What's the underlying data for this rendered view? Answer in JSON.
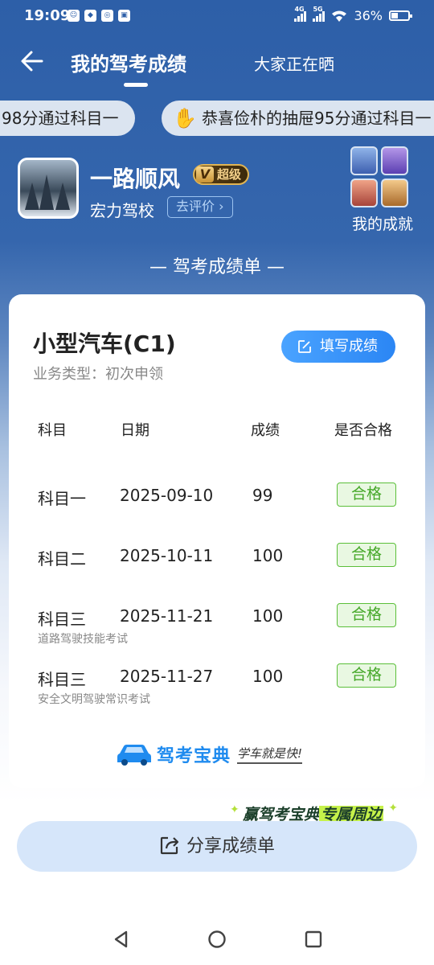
{
  "status": {
    "time": "19:09",
    "net1": "4G",
    "net2": "5G",
    "battery": "36%"
  },
  "header": {
    "tab_active": "我的驾考成绩",
    "tab_other": "大家正在晒"
  },
  "ticker": {
    "item1": "98分通过科目一",
    "item2": "恭喜俭朴的抽屉95分通过科目一"
  },
  "profile": {
    "name": "一路顺风",
    "vip_level": "超级",
    "vip_mark": "V",
    "school": "宏力驾校",
    "rate_label": "去评价",
    "achievements_label": "我的成就"
  },
  "section_title": "— 驾考成绩单 —",
  "card": {
    "vehicle": "小型汽车(C1)",
    "business": "业务类型：初次申领",
    "fill_label": "填写成绩",
    "columns": [
      "科目",
      "日期",
      "成绩",
      "是否合格"
    ],
    "rows": [
      {
        "subject": "科目一",
        "date": "2025-09-10",
        "score": "99",
        "status": "合格",
        "note": ""
      },
      {
        "subject": "科目二",
        "date": "2025-10-11",
        "score": "100",
        "status": "合格",
        "note": ""
      },
      {
        "subject": "科目三",
        "date": "2025-11-21",
        "score": "100",
        "status": "合格",
        "note": "道路驾驶技能考试"
      },
      {
        "subject": "科目三",
        "date": "2025-11-27",
        "score": "100",
        "status": "合格",
        "note": "安全文明驾驶常识考试"
      }
    ],
    "brand_name": "驾考宝典",
    "brand_slogan": "学车就是快!"
  },
  "promo": {
    "text1": "赢驾考宝典",
    "text2": "专属周边"
  },
  "share_label": "分享成绩单",
  "colors": {
    "primary": "#2d5fa8",
    "accent": "#2b86f4",
    "pass": "#46a829"
  }
}
